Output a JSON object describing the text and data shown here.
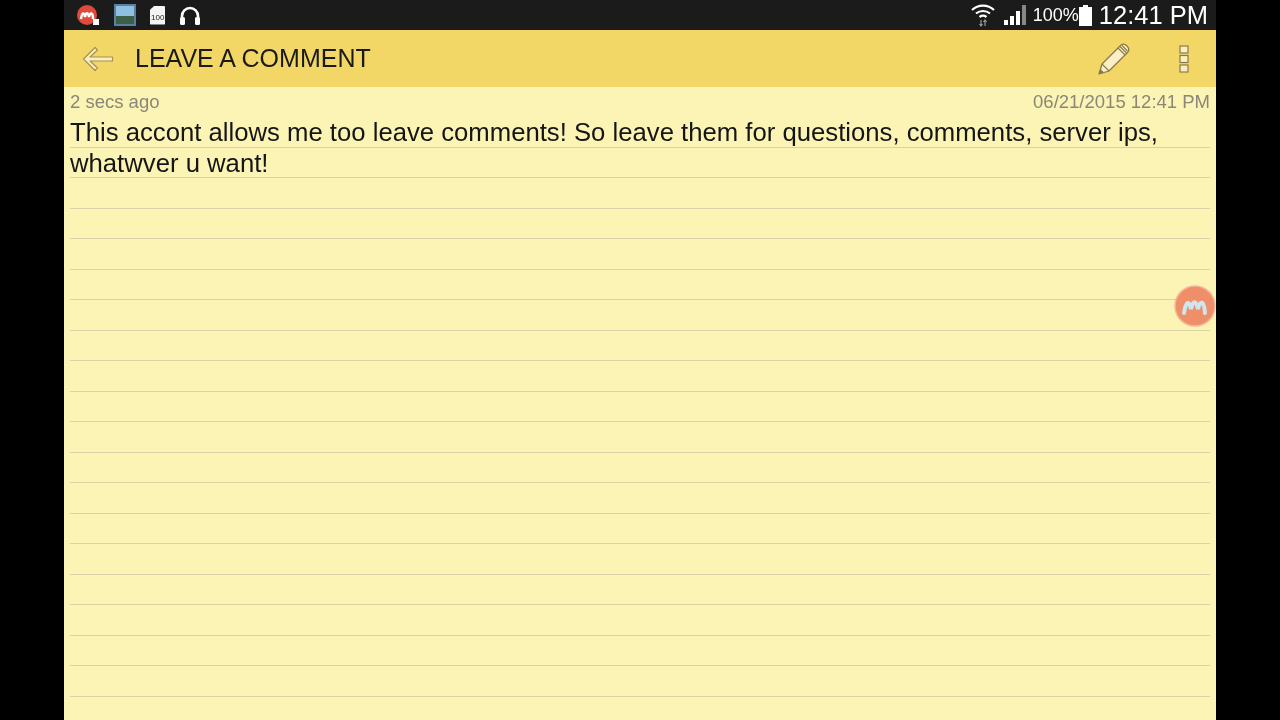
{
  "status_bar": {
    "notification_badge": "100",
    "battery": "100%",
    "time": "12:41 PM"
  },
  "app_bar": {
    "title": "LEAVE A COMMENT"
  },
  "comment": {
    "age": "2 secs ago",
    "timestamp": "06/21/2015 12:41 PM",
    "text": "This accont allows me too leave comments! So leave them for questions, comments, server ips, whatwver u want!"
  }
}
